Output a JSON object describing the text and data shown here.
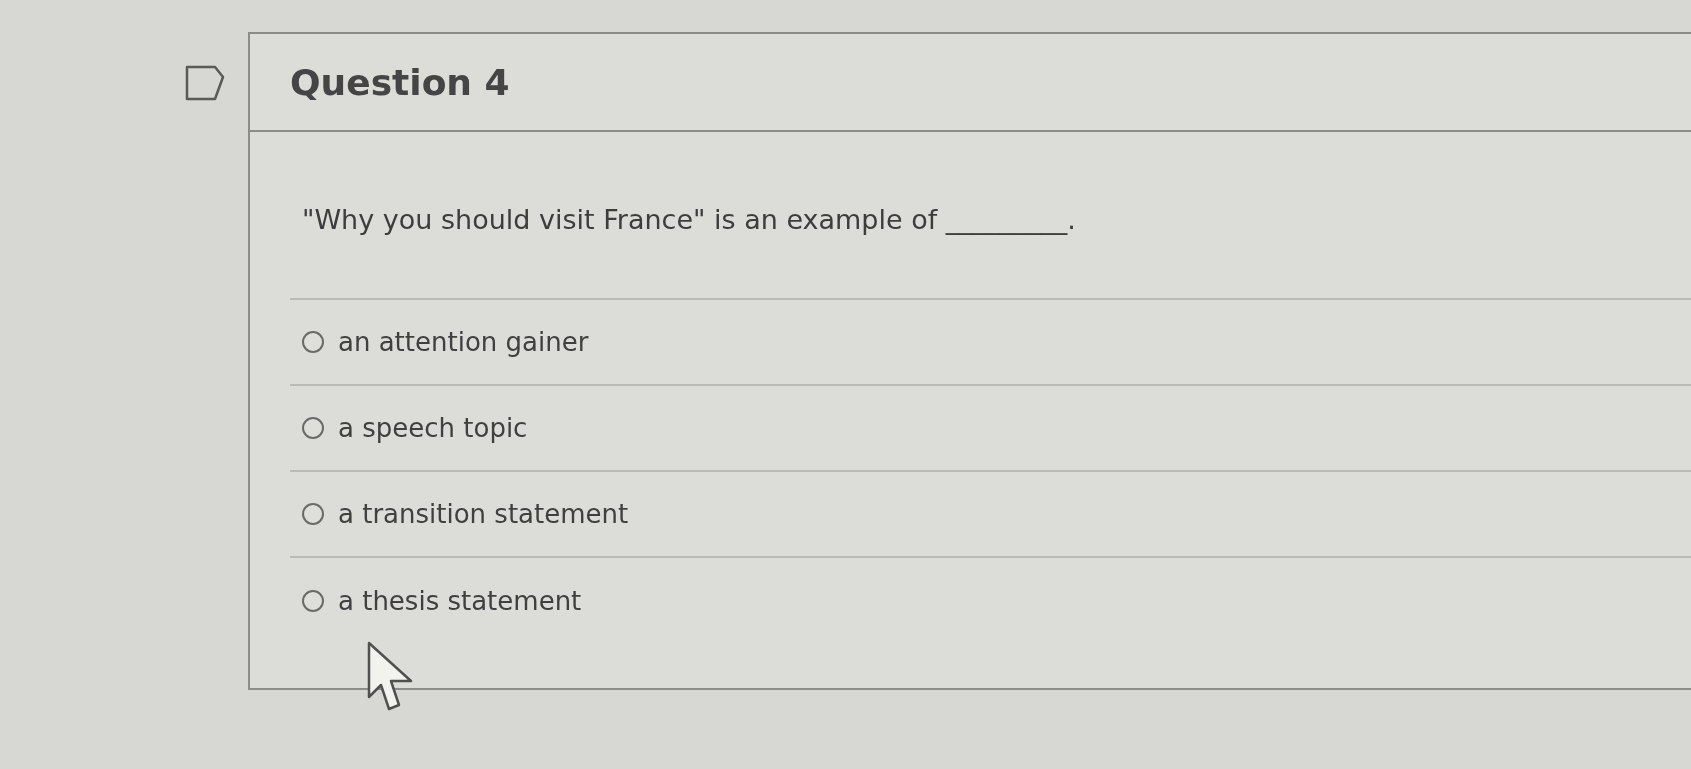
{
  "question": {
    "flagged": false,
    "title": "Question 4",
    "prompt": "\"Why you should visit France\" is an example of _________.",
    "options": [
      {
        "label": "an attention gainer",
        "selected": false
      },
      {
        "label": "a speech topic",
        "selected": false
      },
      {
        "label": "a transition statement",
        "selected": false
      },
      {
        "label": "a thesis statement",
        "selected": false
      }
    ]
  }
}
